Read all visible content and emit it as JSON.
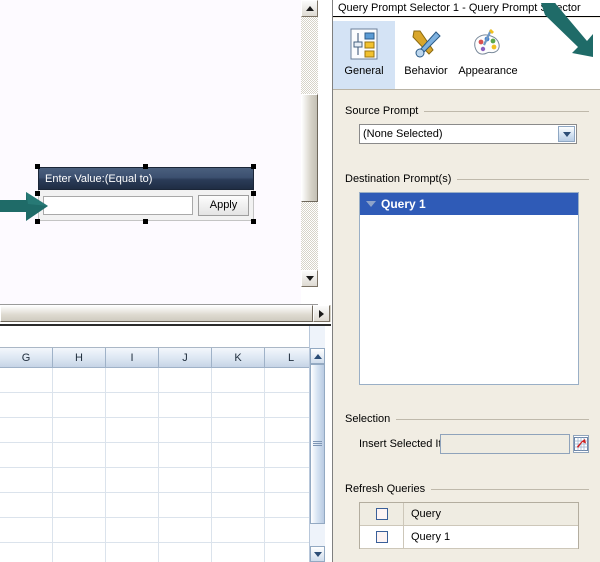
{
  "left": {
    "prompt_widget": {
      "title_main": "Enter Value:",
      "title_sub": "(Equal to)",
      "input_value": "",
      "input_placeholder": "",
      "apply_label": "Apply"
    },
    "sheet": {
      "columns": [
        "G",
        "H",
        "I",
        "J",
        "K",
        "L"
      ],
      "row_count": 8,
      "formula_value": ""
    }
  },
  "right": {
    "title": "Query Prompt Selector 1 - Query Prompt Selector",
    "tabs": [
      {
        "label": "General",
        "icon": "sliders-icon",
        "selected": true
      },
      {
        "label": "Behavior",
        "icon": "tools-icon",
        "selected": false
      },
      {
        "label": "Appearance",
        "icon": "palette-icon",
        "selected": false
      }
    ],
    "source_prompt": {
      "group_label": "Source Prompt",
      "selected_value": "(None Selected)",
      "options": [
        "(None Selected)"
      ]
    },
    "destination_prompts": {
      "group_label": "Destination Prompt(s)",
      "items": [
        {
          "label": "Query 1",
          "selected": true
        }
      ]
    },
    "selection": {
      "group_label": "Selection",
      "field_label": "Insert Selected It...",
      "field_value": "",
      "range_button_icon": "range-select-icon"
    },
    "refresh_queries": {
      "group_label": "Refresh Queries",
      "columns": [
        "",
        "Query"
      ],
      "header_checkbox_checked": false,
      "rows": [
        {
          "checked": false,
          "query": "Query 1"
        }
      ]
    }
  },
  "annotations": {
    "arrow_color": "#1f6b68",
    "arrows": [
      {
        "name": "arrow-pointing-prompt-input",
        "direction": "right"
      },
      {
        "name": "arrow-pointing-range-button",
        "direction": "down-right"
      }
    ]
  }
}
